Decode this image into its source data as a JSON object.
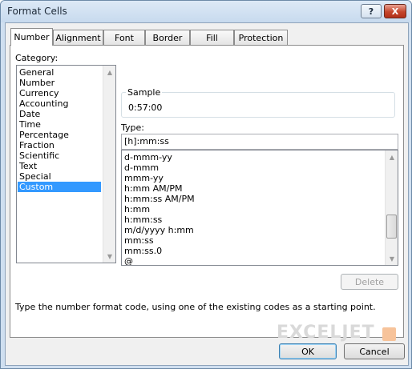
{
  "window": {
    "title": "Format Cells",
    "help_glyph": "?",
    "close_glyph": "X"
  },
  "tabs": [
    {
      "label": "Number",
      "active": true
    },
    {
      "label": "Alignment"
    },
    {
      "label": "Font"
    },
    {
      "label": "Border"
    },
    {
      "label": "Fill"
    },
    {
      "label": "Protection"
    }
  ],
  "category": {
    "label": "Category:",
    "items": [
      "General",
      "Number",
      "Currency",
      "Accounting",
      "Date",
      "Time",
      "Percentage",
      "Fraction",
      "Scientific",
      "Text",
      "Special",
      "Custom"
    ],
    "selected": "Custom"
  },
  "sample": {
    "label": "Sample",
    "value": "0:57:00"
  },
  "type": {
    "label": "Type:",
    "value": "[h]:mm:ss",
    "items": [
      "d-mmm-yy",
      "d-mmm",
      "mmm-yy",
      "h:mm AM/PM",
      "h:mm:ss AM/PM",
      "h:mm",
      "h:mm:ss",
      "m/d/yyyy h:mm",
      "mm:ss",
      "mm:ss.0",
      "@"
    ]
  },
  "buttons": {
    "delete": "Delete",
    "ok": "OK",
    "cancel": "Cancel"
  },
  "description": "Type the number format code, using one of the existing codes as a starting point.",
  "watermark": "EXCELJET",
  "colors": {
    "selection": "#3399ff",
    "titlebar": "#c7daee",
    "close_button": "#c5462c"
  }
}
